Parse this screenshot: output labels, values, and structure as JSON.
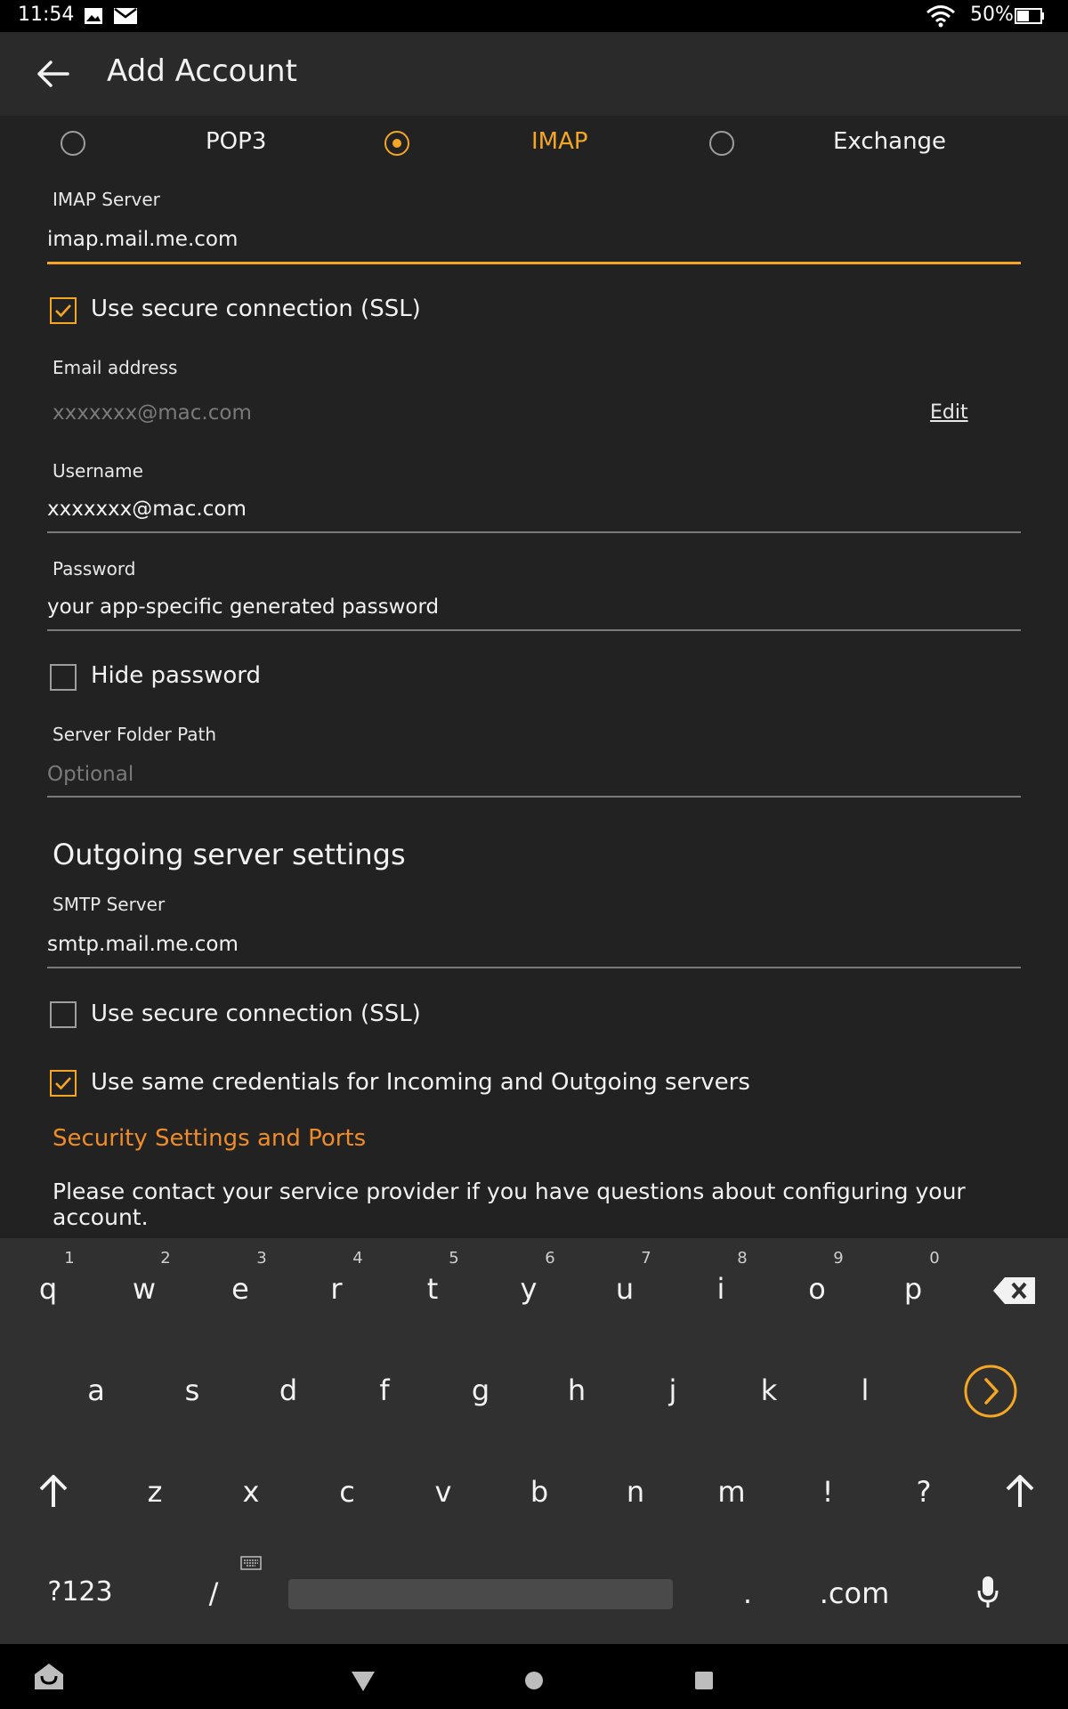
{
  "status_bar": {
    "time": "11:54",
    "battery": "50%"
  },
  "app_bar": {
    "title": "Add Account"
  },
  "account_types": [
    {
      "label": "POP3",
      "selected": false
    },
    {
      "label": "IMAP",
      "selected": true
    },
    {
      "label": "Exchange",
      "selected": false
    }
  ],
  "incoming": {
    "server_label": "IMAP Server",
    "server_value": "imap.mail.me.com",
    "ssl_label": "Use secure connection (SSL)",
    "ssl_checked": true,
    "email_label": "Email address",
    "email_value": "xxxxxxx@mac.com",
    "edit_label": "Edit",
    "username_label": "Username",
    "username_value": "xxxxxxx@mac.com",
    "password_label": "Password",
    "password_value": "your app-specific generated password",
    "hide_password_label": "Hide password",
    "hide_password_checked": false,
    "folder_label": "Server Folder Path",
    "folder_placeholder": "Optional"
  },
  "outgoing": {
    "heading": "Outgoing server settings",
    "server_label": "SMTP Server",
    "server_value": "smtp.mail.me.com",
    "ssl_label": "Use secure connection (SSL)",
    "ssl_checked": false,
    "same_creds_label": "Use same credentials for Incoming and Outgoing servers",
    "same_creds_checked": true
  },
  "security_link": "Security Settings and Ports",
  "note": "Please contact your service provider if you have questions about configuring your account.",
  "keyboard": {
    "row1": [
      "q",
      "w",
      "e",
      "r",
      "t",
      "y",
      "u",
      "i",
      "o",
      "p"
    ],
    "row1_hints": [
      "1",
      "2",
      "3",
      "4",
      "5",
      "6",
      "7",
      "8",
      "9",
      "0"
    ],
    "row2": [
      "a",
      "s",
      "d",
      "f",
      "g",
      "h",
      "j",
      "k",
      "l"
    ],
    "row3": [
      "z",
      "x",
      "c",
      "v",
      "b",
      "n",
      "m",
      "!",
      "?"
    ],
    "symbols_key": "?123",
    "slash_key": "/",
    "period_key": ".",
    "dotcom_key": ".com"
  },
  "colors": {
    "accent": "#f5a623",
    "link": "#f08c28",
    "background": "#222222"
  }
}
